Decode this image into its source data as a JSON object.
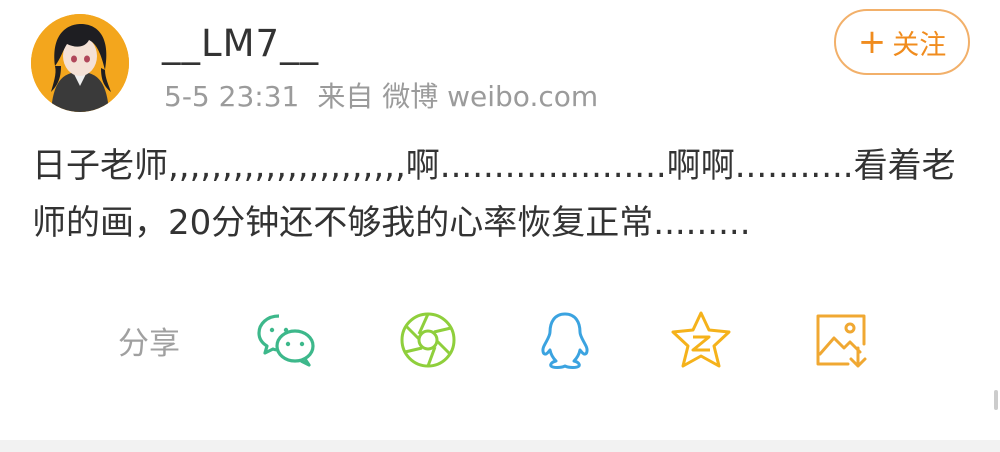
{
  "post": {
    "username": "__LM7__",
    "timestamp": "5-5 23:31",
    "source": "来自 微博 weibo.com",
    "avatar_icon": "anime-girl-avatar-icon",
    "follow_label": "关注",
    "content": "日子老师,,,,,,,,,,,,,,,,,,,,,,啊.....................啊啊...........看着老师的画，20分钟还不够我的心率恢复正常........."
  },
  "share": {
    "label": "分享",
    "targets": [
      {
        "icon": "wechat-icon",
        "color": "#3db88b"
      },
      {
        "icon": "moments-icon",
        "color": "#8fcf3c"
      },
      {
        "icon": "qq-icon",
        "color": "#3ba3e0"
      },
      {
        "icon": "qzone-icon",
        "color": "#f5b21b"
      },
      {
        "icon": "save-image-icon",
        "color": "#f0a832"
      }
    ]
  },
  "colors": {
    "accent": "#f08c1e",
    "text": "#333333",
    "muted": "#9b9b9b"
  }
}
